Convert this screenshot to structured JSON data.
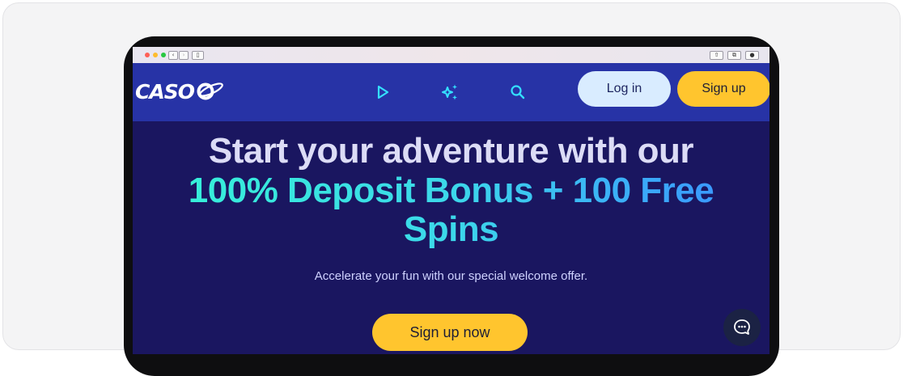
{
  "nav": {
    "logo_text": "CASOO",
    "icons": [
      "play-icon",
      "sparkles-icon",
      "search-icon"
    ],
    "login_label": "Log in",
    "signup_label": "Sign up"
  },
  "hero": {
    "line1": "Start your adventure with our",
    "line2": "100% Deposit Bonus + 100 Free Spins",
    "subtitle": "Accelerate your fun with our special welcome offer.",
    "cta_label": "Sign up now"
  },
  "chat": {
    "icon": "chat-icon"
  },
  "colors": {
    "nav_bg": "#2733a6",
    "hero_bg": "#1a1660",
    "accent_yellow": "#ffc52e",
    "login_bg": "#d9ecff",
    "icon_cyan": "#34e0ff",
    "headline_gradient": [
      "#36f0d8",
      "#3a96ff"
    ]
  }
}
